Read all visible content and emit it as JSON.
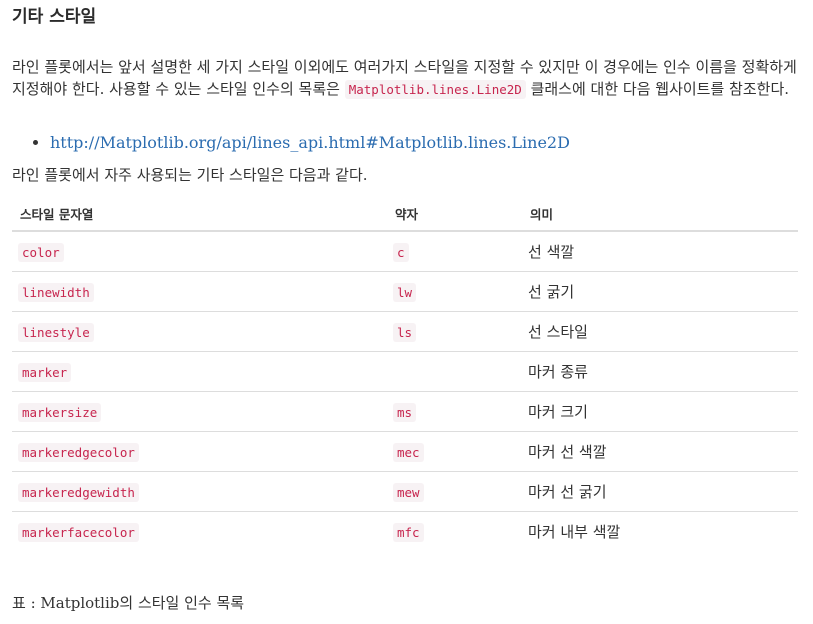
{
  "heading": "기타 스타일",
  "paragraph1": {
    "text_before": "라인 플롯에서는 앞서 설명한 세 가지 스타일 이외에도 여러가지 스타일을 지정할 수 있지만 이 경우에는 인수 이름을 정확하게 지정해야 한다. 사용할 수 있는 스타일 인수의 목록은 ",
    "code": "Matplotlib.lines.Line2D",
    "text_after": " 클래스에 대한 다음 웹사이트를 참조한다."
  },
  "link": {
    "text": "http://Matplotlib.org/api/lines_api.html#Matplotlib.lines.Line2D"
  },
  "paragraph2": "라인 플롯에서 자주 사용되는 기타 스타일은 다음과 같다.",
  "table": {
    "headers": [
      "스타일 문자열",
      "약자",
      "의미"
    ],
    "rows": [
      {
        "name": "color",
        "abbr": "c",
        "meaning": "선 색깔"
      },
      {
        "name": "linewidth",
        "abbr": "lw",
        "meaning": "선 굵기"
      },
      {
        "name": "linestyle",
        "abbr": "ls",
        "meaning": "선 스타일"
      },
      {
        "name": "marker",
        "abbr": "",
        "meaning": "마커 종류"
      },
      {
        "name": "markersize",
        "abbr": "ms",
        "meaning": "마커 크기"
      },
      {
        "name": "markeredgecolor",
        "abbr": "mec",
        "meaning": "마커 선 색깔"
      },
      {
        "name": "markeredgewidth",
        "abbr": "mew",
        "meaning": "마커 선 굵기"
      },
      {
        "name": "markerfacecolor",
        "abbr": "mfc",
        "meaning": "마커 내부 색깔"
      }
    ]
  },
  "caption": "표 : Matplotlib의 스타일 인수 목록",
  "colors": {
    "link": "#2b6cb0",
    "code_text": "#c7254e",
    "code_bg": "#f7f2f4"
  }
}
